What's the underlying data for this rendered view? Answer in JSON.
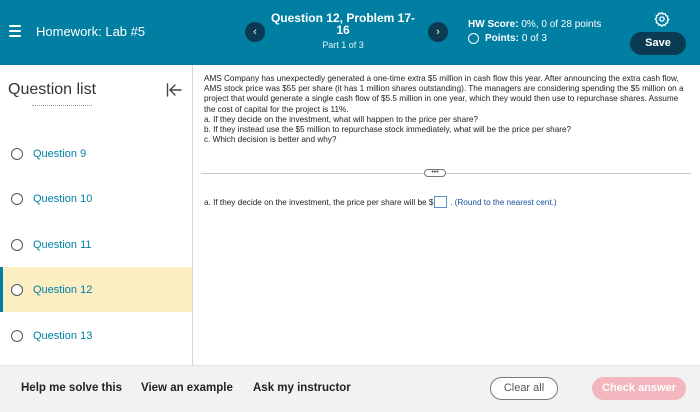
{
  "header": {
    "title": "Homework: Lab #5",
    "problem_title": "Question 12, Problem 17-16",
    "part": "Part 1 of 3",
    "prev_glyph": "‹",
    "next_glyph": "›",
    "hw_score_label": "HW Score:",
    "hw_score_value": "0%, 0 of 28 points",
    "points_label": "Points:",
    "points_value": "0 of 3",
    "save_label": "Save"
  },
  "sidebar": {
    "title": "Question list",
    "items": [
      {
        "label": "Question 9"
      },
      {
        "label": "Question 10"
      },
      {
        "label": "Question 11"
      },
      {
        "label": "Question 12"
      },
      {
        "label": "Question 13"
      }
    ]
  },
  "question": {
    "paragraph": "AMS Company has unexpectedly generated a one-time extra $5 million in cash flow this year. After announcing the extra cash flow, AMS stock price was $55 per share (it has 1 million shares outstanding). The managers are considering spending the $5 million on a project that would generate a single cash flow of $5.5 million in one year, which they would then use to repurchase shares. Assume the cost of capital for the project is 11%.",
    "part_a": "a. If they decide on the investment, what will happen to the price per share?",
    "part_b": "b. If they instead use the $5 million to repurchase stock immediately, what will be the price per share?",
    "part_c": "c. Which decision is better and why?",
    "expand_label": "•••",
    "answer_prefix": "a. If they decide on the investment, the price per share will be $",
    "answer_value": "",
    "answer_suffix": ".",
    "hint": "(Round to the nearest cent.)"
  },
  "footer": {
    "help_label": "Help me solve this",
    "example_label": "View an example",
    "instructor_label": "Ask my instructor",
    "clear_label": "Clear all",
    "check_label": "Check answer"
  },
  "colors": {
    "header_bg": "#007fa3",
    "dark_button": "#0b3b52",
    "active_item_bg": "#fbeec2",
    "link_blue": "#007fa3",
    "check_button": "#f3b6be"
  }
}
